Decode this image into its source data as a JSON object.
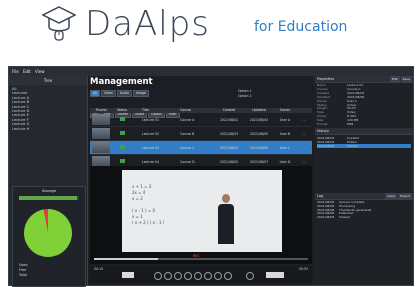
{
  "hero": {
    "logo_text": "DaAlps",
    "sub_text": "for Education"
  },
  "menubar": {
    "items": [
      "File",
      "Edit",
      "View"
    ]
  },
  "left": {
    "header": "Tree",
    "tree": [
      "All",
      "Lectures",
      "Lecture A",
      "Lecture B",
      "Lecture C",
      "Lecture D",
      "Lecture E",
      "Lecture F",
      "Lecture G",
      "Lecture H"
    ],
    "storage_caption": "Storage",
    "storage_used_fraction": 0.97,
    "legend": [
      "Used",
      "Free",
      "Total"
    ]
  },
  "center": {
    "title": "Management",
    "tabs": [
      "All",
      "Video",
      "Audio",
      "Image"
    ],
    "toolbar_buttons": [
      "Up",
      "Edit",
      "Delete",
      "Share",
      "Export",
      "Filter"
    ],
    "options": [
      "Option 1",
      "Option 2"
    ],
    "columns": [
      "Thumb",
      "Status",
      "",
      "Title",
      "Course",
      "Created",
      "Updated",
      "Owner",
      ""
    ],
    "rows": [
      {
        "title": "Lecture 01",
        "course": "Course A",
        "created": "2021/08/02",
        "updated": "2021/08/04",
        "owner": "User A",
        "selected": false
      },
      {
        "title": "Lecture 02",
        "course": "Course B",
        "created": "2021/08/03",
        "updated": "2021/08/05",
        "owner": "User B",
        "selected": false
      },
      {
        "title": "Lecture 03",
        "course": "Course C",
        "created": "2021/08/04",
        "updated": "2021/08/06",
        "owner": "User C",
        "selected": true
      },
      {
        "title": "Lecture 04",
        "course": "Course D",
        "created": "2021/08/05",
        "updated": "2021/08/07",
        "owner": "User D",
        "selected": false
      }
    ],
    "video": {
      "badge": "REC",
      "time_current": "00:15",
      "time_total": "00:53",
      "progress": 0.3,
      "board_text": "x + 1 = 3\n2x = 4\nx = 2\n\n( x - 1 ) = 0\nx = 1\n( x + 2 ) ( x - 1 )"
    }
  },
  "right": {
    "props_header": "Properties",
    "props_buttons": [
      "Edit",
      "Save"
    ],
    "props": [
      {
        "k": "Name",
        "v": "Lecture 03"
      },
      {
        "k": "Course",
        "v": "Course C"
      },
      {
        "k": "Created",
        "v": "2021/08/04"
      },
      {
        "k": "Updated",
        "v": "2021/08/06"
      },
      {
        "k": "Owner",
        "v": "User C"
      },
      {
        "k": "Status",
        "v": "Active"
      },
      {
        "k": "Length",
        "v": "00:53"
      },
      {
        "k": "Type",
        "v": "Video"
      },
      {
        "k": "Codec",
        "v": "H.264"
      },
      {
        "k": "Size",
        "v": "120 MB"
      },
      {
        "k": "Format",
        "v": "MP4"
      }
    ],
    "history_header": "History",
    "history": [
      {
        "t": "2021/08/04",
        "v": "Created",
        "sel": false
      },
      {
        "t": "2021/08/05",
        "v": "Edited",
        "sel": false
      },
      {
        "t": "2021/08/06",
        "v": "Shared",
        "sel": true
      }
    ],
    "log_header": "Log",
    "log_buttons": [
      "Clear",
      "Export"
    ],
    "log": [
      {
        "t": "2021/08/06",
        "v": "Upload complete"
      },
      {
        "t": "2021/08/06",
        "v": "Processing"
      },
      {
        "t": "2021/08/06",
        "v": "Thumbnail generated"
      },
      {
        "t": "2021/08/06",
        "v": "Published"
      },
      {
        "t": "2021/08/06",
        "v": "Viewed"
      }
    ]
  }
}
